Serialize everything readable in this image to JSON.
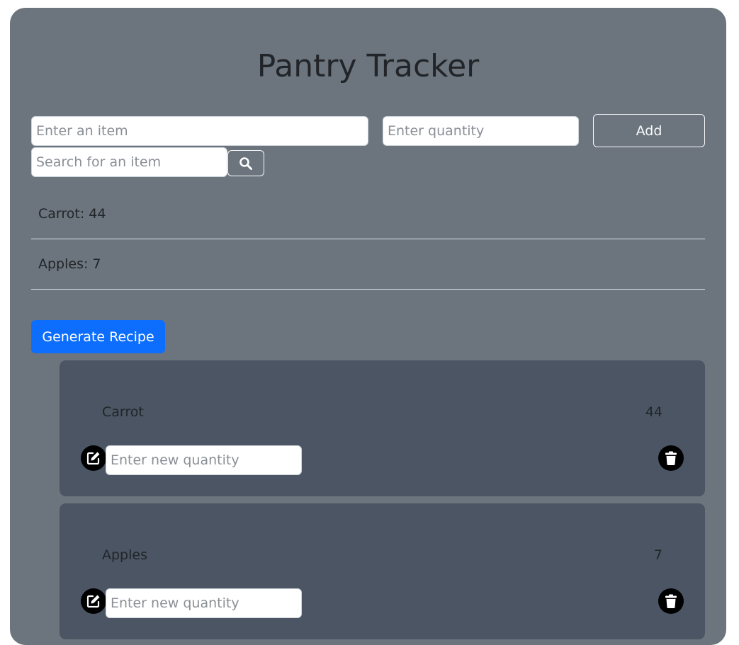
{
  "header": {
    "title": "Pantry Tracker"
  },
  "add_form": {
    "item_placeholder": "Enter an item",
    "quantity_placeholder": "Enter quantity",
    "add_label": "Add"
  },
  "search": {
    "placeholder": "Search for an item",
    "icon": "search-icon"
  },
  "inventory_summary": [
    "Carrot: 44",
    "Apples: 7"
  ],
  "generate_recipe_label": "Generate Recipe",
  "cards": [
    {
      "name": "Carrot",
      "quantity": "44",
      "new_quantity_placeholder": "Enter new quantity",
      "edit_icon": "edit-icon",
      "delete_icon": "trash-icon"
    },
    {
      "name": "Apples",
      "quantity": "7",
      "new_quantity_placeholder": "Enter new quantity",
      "edit_icon": "edit-icon",
      "delete_icon": "trash-icon"
    }
  ],
  "colors": {
    "panel_background": "#6c757d",
    "card_background": "#4b5563",
    "primary_button": "#0d6efd",
    "text": "#212529"
  }
}
